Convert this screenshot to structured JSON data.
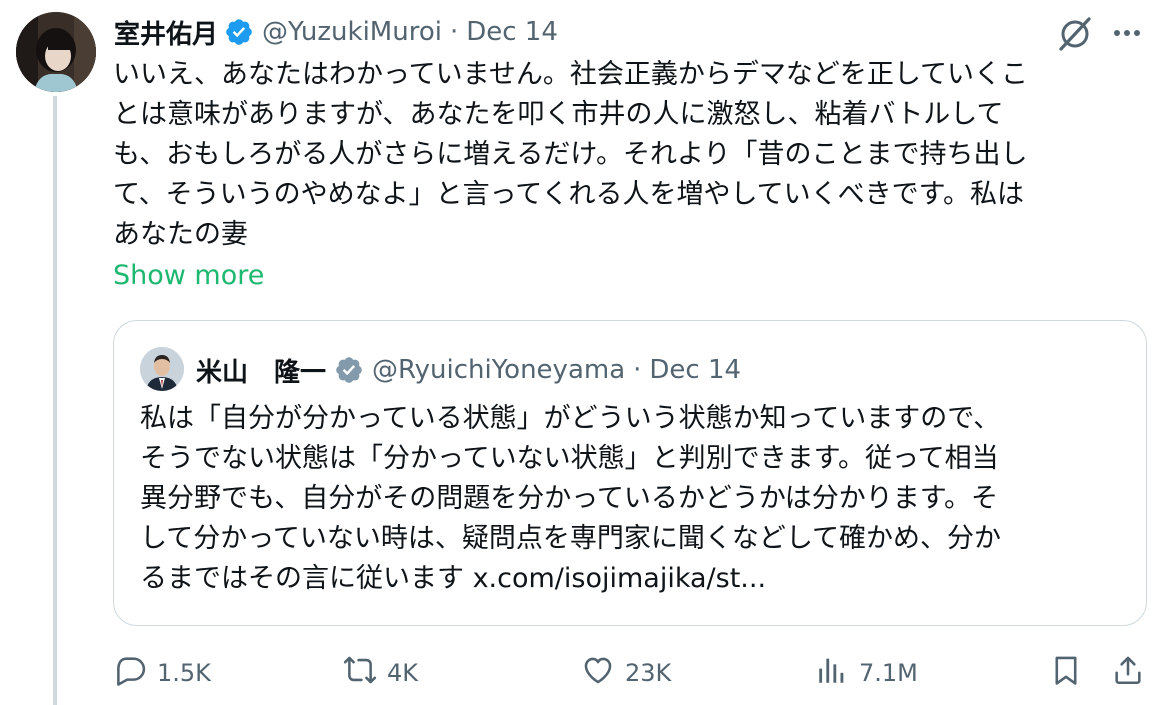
{
  "colors": {
    "accent": "#1d9bf0",
    "show_more": "#1db870",
    "muted": "#536471",
    "text": "#0f1419",
    "border": "#cfd9de"
  },
  "author": {
    "display_name": "室井佑月",
    "handle": "@YuzukiMuroi",
    "separator": "·",
    "date": "Dec 14"
  },
  "tweet": {
    "lines": [
      "いいえ、あなたはわかっていません。社会正義からデマなどを正していくこ",
      "とは意味がありますが、あなたを叩く市井の人に激怒し、粘着バトルして",
      "も、おもしろがる人がさらに増えるだけ。それより「昔のことまで持ち出し",
      "て、そういうのやめなよ」と言ってくれる人を増やしていくべきです。私は",
      "あなたの妻"
    ],
    "show_more": "Show more"
  },
  "quote": {
    "display_name": "米山　隆一",
    "handle": "@RyuichiYoneyama",
    "separator": "·",
    "date": "Dec 14",
    "lines": [
      "私は「自分が分かっている状態」がどういう状態か知っていますので、",
      "そうでない状態は「分かっていない状態」と判別できます。従って相当",
      "異分野でも、自分がその問題を分かっているかどうかは分かります。そ",
      "して分かっていない時は、疑問点を専門家に聞くなどして確かめ、分か",
      "るまではその言に従います x.com/isojimajika/st..."
    ]
  },
  "actions": {
    "reply": {
      "icon": "reply-icon",
      "count": "1.5K"
    },
    "repost": {
      "icon": "repost-icon",
      "count": "4K"
    },
    "like": {
      "icon": "heart-icon",
      "count": "23K"
    },
    "views": {
      "icon": "views-icon",
      "count": "7.1M"
    },
    "bookmark": {
      "icon": "bookmark-icon"
    },
    "share": {
      "icon": "share-icon"
    }
  }
}
